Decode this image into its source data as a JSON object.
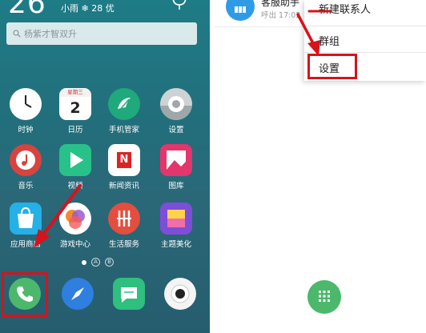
{
  "home": {
    "time": "26",
    "weather": "小雨 ❄ 28 优",
    "search_placeholder": "杨紫才智双升",
    "apps": [
      {
        "label": "时钟",
        "icon": "clock-icon"
      },
      {
        "label": "日历",
        "icon": "calendar-icon",
        "weekday": "星期三",
        "day": "2"
      },
      {
        "label": "手机管家",
        "icon": "phone-manager-icon"
      },
      {
        "label": "设置",
        "icon": "settings-gear-icon"
      },
      {
        "label": "音乐",
        "icon": "music-icon"
      },
      {
        "label": "视频",
        "icon": "video-play-icon"
      },
      {
        "label": "新闻资讯",
        "icon": "news-icon",
        "glyph": "N"
      },
      {
        "label": "图库",
        "icon": "gallery-icon"
      },
      {
        "label": "应用商店",
        "icon": "app-store-bag-icon"
      },
      {
        "label": "游戏中心",
        "icon": "game-center-icon"
      },
      {
        "label": "生活服务",
        "icon": "life-service-icon"
      },
      {
        "label": "主题美化",
        "icon": "theme-icon"
      }
    ],
    "page_indicators": [
      "",
      "A",
      "B"
    ],
    "dock": [
      {
        "icon": "phone-icon"
      },
      {
        "icon": "browser-compass-icon"
      },
      {
        "icon": "message-icon"
      },
      {
        "icon": "camera-icon"
      }
    ],
    "colors": {
      "highlight": "#d8121b",
      "phone_green": "#4cb86b"
    }
  },
  "contacts": {
    "top_contact": {
      "name": "客服助手",
      "sub": "呼出  17:02"
    },
    "menu": [
      {
        "label": "新建联系人"
      },
      {
        "label": "群组"
      },
      {
        "label": "设置"
      }
    ],
    "fab_icon": "dialpad-icon"
  }
}
